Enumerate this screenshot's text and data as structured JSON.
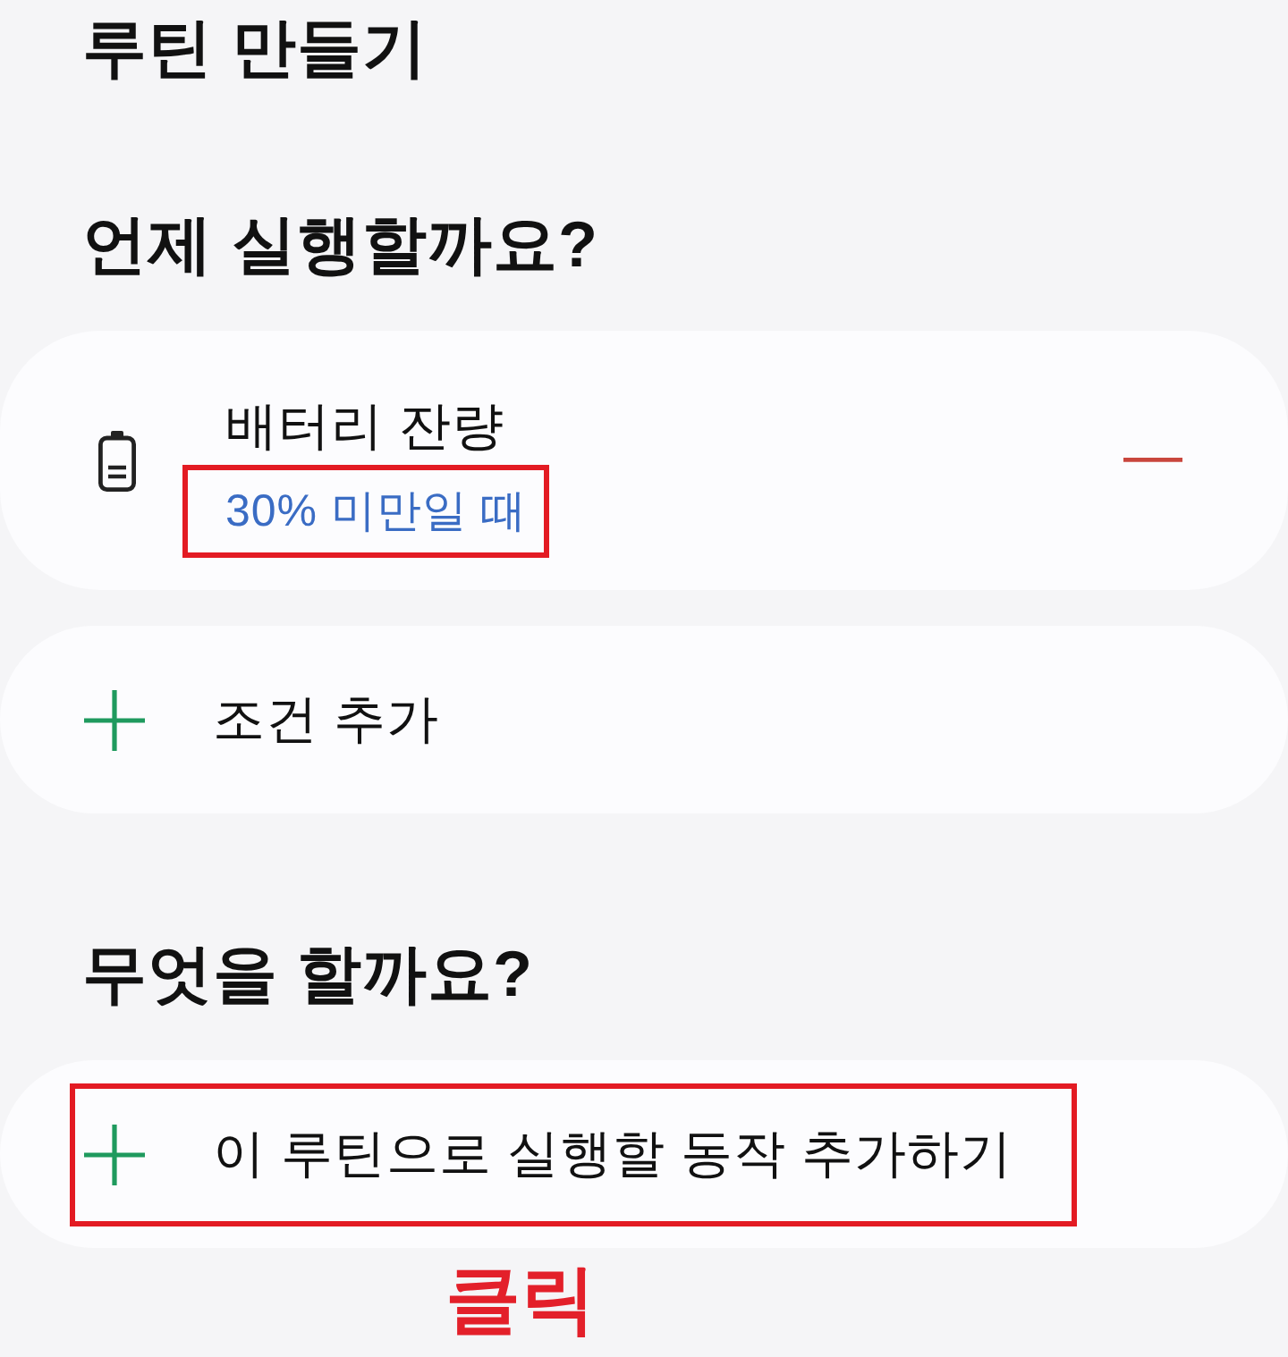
{
  "header": {
    "title": "루틴 만들기"
  },
  "sections": [
    {
      "heading": "언제 실행할까요?",
      "rows": [
        {
          "kind": "condition",
          "title": "배터리 잔량",
          "detail": "30% 미만일 때",
          "detail_highlighted": true
        },
        {
          "kind": "add",
          "label": "조건 추가",
          "highlighted": false
        }
      ]
    },
    {
      "heading": "무엇을 할까요?",
      "rows": [
        {
          "kind": "add",
          "label": "이 루틴으로 실행할 동작 추가하기",
          "highlighted": true
        }
      ]
    }
  ],
  "callout": {
    "text": "클릭"
  }
}
